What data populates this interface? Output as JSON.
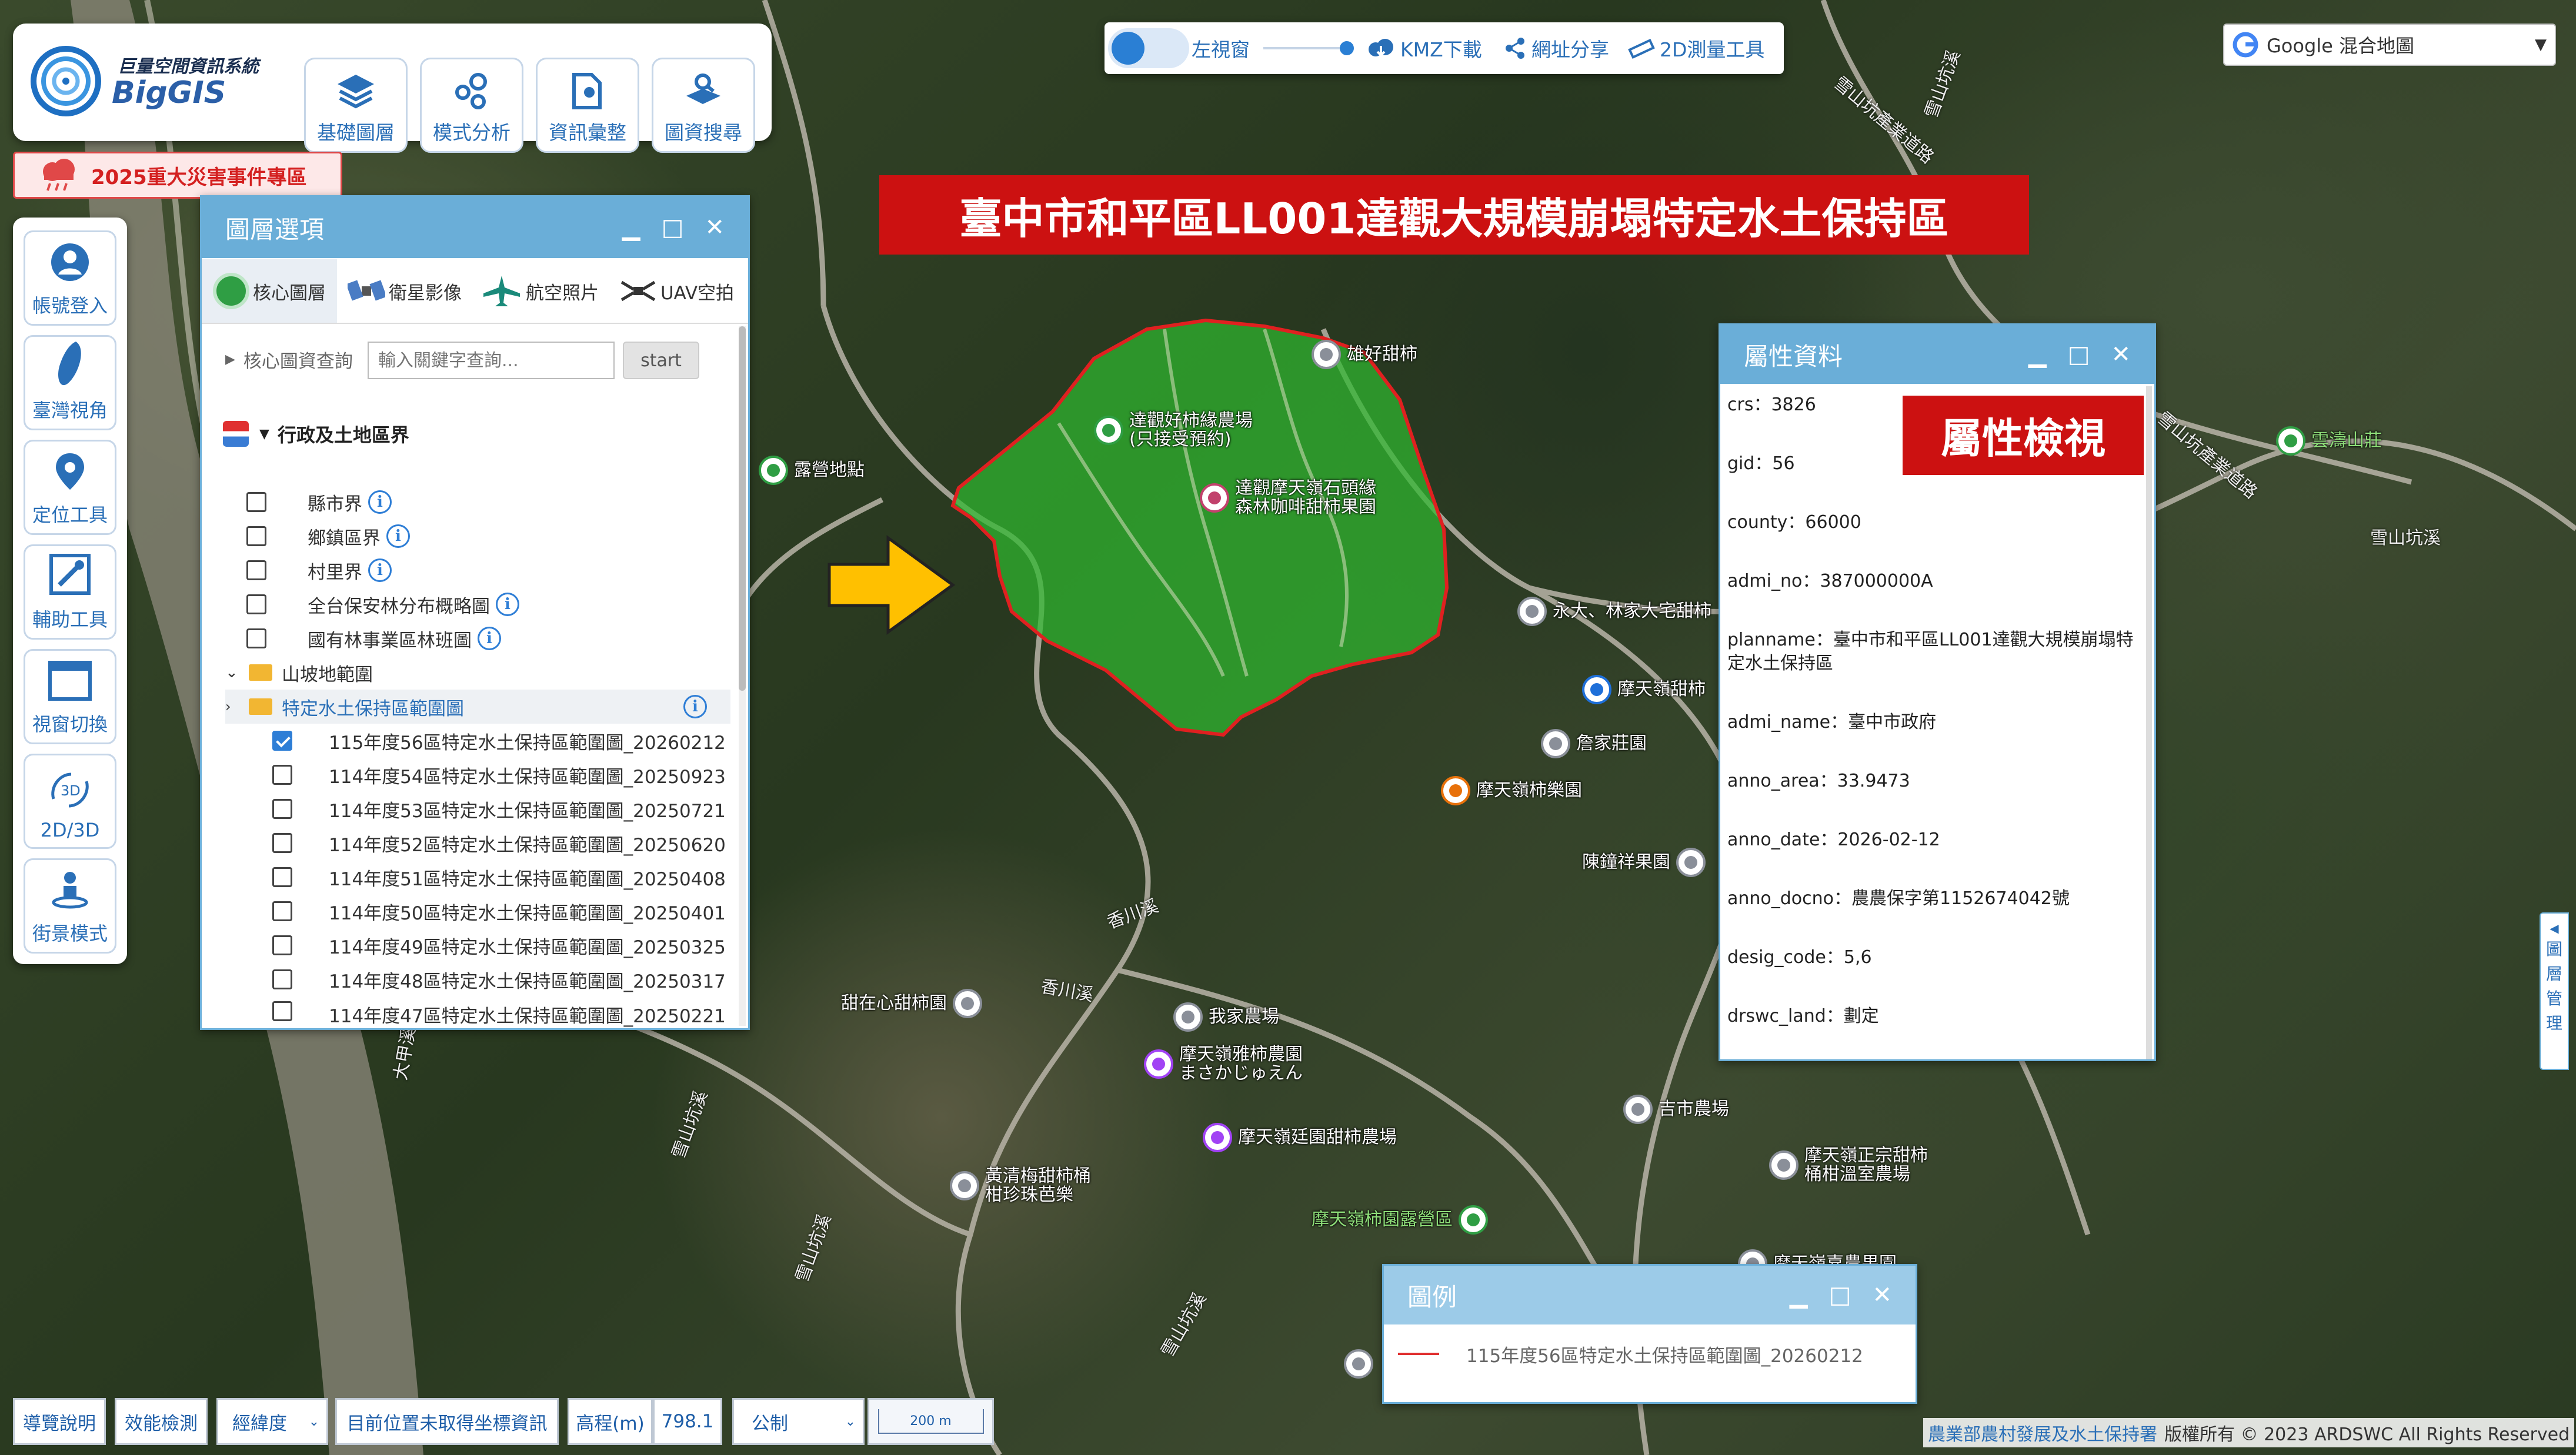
{
  "app": {
    "logo_title": "巨量空間資訊系統",
    "logo_name": "BigGIS"
  },
  "toolbar": [
    {
      "label": "基礎圖層",
      "icon": "layers-icon"
    },
    {
      "label": "模式分析",
      "icon": "analysis-icon"
    },
    {
      "label": "資訊彙整",
      "icon": "document-pin-icon"
    },
    {
      "label": "圖資搜尋",
      "icon": "map-search-icon"
    }
  ],
  "disaster_banner": "2025重大災害事件專區",
  "sidebar": [
    {
      "label": "帳號登入",
      "icon": "user-icon"
    },
    {
      "label": "臺灣視角",
      "icon": "taiwan-icon"
    },
    {
      "label": "定位工具",
      "icon": "location-pin-icon"
    },
    {
      "label": "輔助工具",
      "icon": "tools-icon"
    },
    {
      "label": "視窗切換",
      "icon": "window-icon"
    },
    {
      "label": "2D/3D",
      "icon": "3d-toggle-icon"
    },
    {
      "label": "街景模式",
      "icon": "street-view-icon"
    }
  ],
  "top_controls": {
    "left_window": "左視窗",
    "kmz": "KMZ下載",
    "share": "網址分享",
    "measure": "2D測量工具"
  },
  "basemap_select": {
    "value": "Google 混合地圖"
  },
  "map_title": "臺中市和平區LL001達觀大規模崩塌特定水土保持區",
  "layer_panel": {
    "title": "圖層選項",
    "tabs": [
      {
        "label": "核心圖層",
        "icon": "core-layer-icon"
      },
      {
        "label": "衛星影像",
        "icon": "satellite-icon"
      },
      {
        "label": "航空照片",
        "icon": "airplane-icon"
      },
      {
        "label": "UAV空拍",
        "icon": "drone-icon"
      }
    ],
    "search_label": "核心圖資查詢",
    "search_placeholder": "輸入關鍵字查詢...",
    "search_button": "start",
    "group_title": "行政及土地區界",
    "items": [
      {
        "label": "縣市界",
        "checked": false
      },
      {
        "label": "鄉鎮區界",
        "checked": false
      },
      {
        "label": "村里界",
        "checked": false
      },
      {
        "label": "全台保安林分布概略圖",
        "checked": false
      },
      {
        "label": "國有林事業區林班圖",
        "checked": false
      }
    ],
    "folder1": "山坡地範圍",
    "folder2": "特定水土保持區範圍圖",
    "sub_items": [
      {
        "label": "115年度56區特定水土保持區範圍圖_20260212",
        "checked": true
      },
      {
        "label": "114年度54區特定水土保持區範圍圖_20250923",
        "checked": false
      },
      {
        "label": "114年度53區特定水土保持區範圍圖_20250721",
        "checked": false
      },
      {
        "label": "114年度52區特定水土保持區範圍圖_20250620",
        "checked": false
      },
      {
        "label": "114年度51區特定水土保持區範圍圖_20250408",
        "checked": false
      },
      {
        "label": "114年度50區特定水土保持區範圍圖_20250401",
        "checked": false
      },
      {
        "label": "114年度49區特定水土保持區範圍圖_20250325",
        "checked": false
      },
      {
        "label": "114年度48區特定水土保持區範圍圖_20250317",
        "checked": false
      },
      {
        "label": "114年度47區特定水土保持區範圍圖_20250221",
        "checked": false
      }
    ]
  },
  "attr_panel": {
    "title": "屬性資料",
    "badge": "屬性檢視",
    "lines": [
      "crs：3826",
      "gid：56",
      "county：66000",
      "admi_no：387000000A",
      "planname：臺中市和平區LL001達觀大規模崩塌特",
      "定水土保持區",
      "admi_name：臺中市政府",
      "anno_area：33.9473",
      "anno_date：2026-02-12",
      "anno_docno：農農保字第1152674042號",
      "desig_code：5,6",
      "drswc_land：劃定"
    ]
  },
  "legend_panel": {
    "title": "圖例",
    "item": "115年度56區特定水土保持區範圍圖_20260212",
    "line_color": "#e03030"
  },
  "right_tab": [
    "圖",
    "層",
    "管",
    "理"
  ],
  "map_pois": [
    "雄好甜柿",
    "達觀好柿緣農場\n(只接受預約)",
    "達觀摩天嶺石頭緣\n森林咖啡甜柿果園",
    "露營地點",
    "永大、林家大宅甜柿",
    "摩天嶺甜柿",
    "詹家莊園",
    "摩天嶺柿樂園",
    "陳鐘祥果園",
    "甜在心甜柿園",
    "我家農場",
    "摩天嶺雅柿農園\nまさかじゅえん",
    "摩天嶺廷園甜柿農場",
    "黃清梅甜柿桶\n柑珍珠芭樂",
    "摩天嶺柿園露營區",
    "吉市農場",
    "摩天嶺正宗甜柿\n桶柑溫室農場",
    "雲濤山莊",
    "摩天嶺嘉農果園"
  ],
  "map_roads": [
    "雪山坑產業道路",
    "雪山坑溪",
    "雪山坑產業道路",
    "雪山坑溪",
    "香川溪",
    "香川溪",
    "大甲溪",
    "雪山坑溪",
    "雪山坑溪",
    "雪山坑溪"
  ],
  "statusbar": {
    "guide": "導覽說明",
    "perf": "效能檢測",
    "coord_type": "經緯度",
    "position": "目前位置未取得坐標資訊",
    "elev_label": "高程(m)",
    "elev_value": "798.1",
    "unit": "公制",
    "scale": "200 m"
  },
  "copyright": {
    "agency": "農業部農村發展及水土保持署",
    "rights": "版權所有 © 2023 ARDSWC All Rights Reserved"
  },
  "colors": {
    "accent": "#2a6fb7",
    "title_bg": "#cc1111",
    "polygon": "#2fb82f",
    "polygon_border": "#e02020",
    "arrow": "#ffc000"
  }
}
